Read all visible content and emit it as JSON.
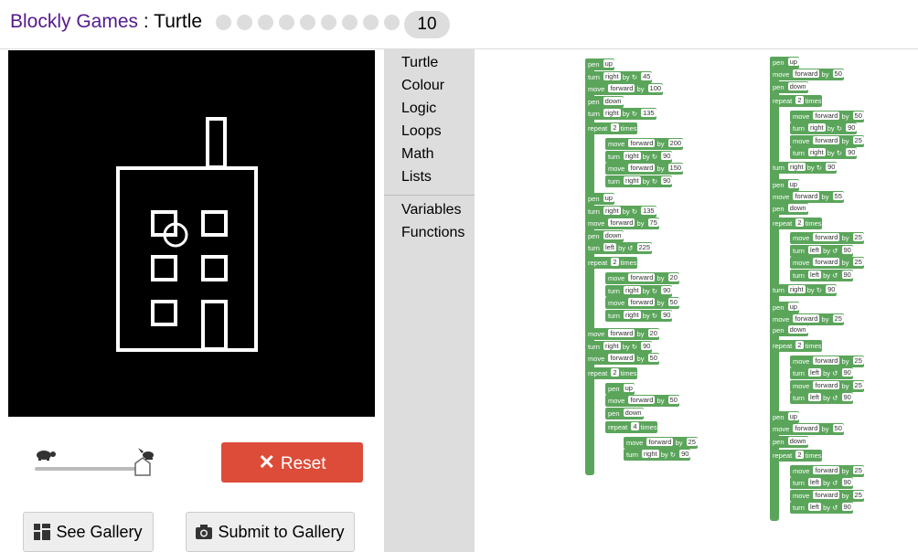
{
  "header": {
    "app_name": "Blockly Games",
    "separator": " : ",
    "game_name": "Turtle",
    "current_level": "10",
    "level_count": 9
  },
  "controls": {
    "reset_label": "Reset",
    "see_gallery_label": "See Gallery",
    "submit_gallery_label": "Submit to Gallery",
    "speed": 0.95
  },
  "toolbox": {
    "categories": [
      "Turtle",
      "Colour",
      "Logic",
      "Loops",
      "Math",
      "Lists",
      "Variables",
      "Functions"
    ]
  },
  "workspace": {
    "col1": [
      "pen up",
      "turn right by ↻ 45",
      "move forward by 100",
      "pen down",
      "turn right by ↻ 135",
      "repeat 2 times",
      "move forward by 200",
      "turn right by ↻ 90",
      "move forward by 150",
      "turn right by ↻ 90",
      "pen up",
      "turn right by ↻ 135",
      "move forward by 75",
      "pen down",
      "turn left by ↺ 225",
      "repeat 2 times",
      "move forward by 20",
      "turn right by ↻ 90",
      "move forward by 50",
      "turn right by ↻ 90",
      "move forward by 20",
      "turn right by ↻ 90",
      "move forward by 50",
      "repeat 2 times",
      "pen up",
      "move forward by 50",
      "pen down",
      "repeat 4 times",
      "move forward by 25",
      "turn right by ↻ 90"
    ],
    "col2": [
      "pen up",
      "move forward by 50",
      "pen down",
      "repeat 2 times",
      "move forward by 50",
      "turn right by ↻ 90",
      "move forward by 25",
      "turn right by ↻ 90",
      "turn right by ↻ 90",
      "pen up",
      "move forward by 55",
      "pen down",
      "repeat 2 times",
      "move forward by 25",
      "turn left by ↺ 90",
      "move forward by 25",
      "turn left by ↺ 90",
      "turn right by ↻ 90",
      "pen up",
      "move forward by 25",
      "pen down",
      "repeat 2 times",
      "move forward by 25",
      "turn left by ↺ 90",
      "move forward by 25",
      "turn left by ↺ 90",
      "pen up",
      "move forward by 50",
      "pen down",
      "repeat 2 times",
      "move forward by 25",
      "turn left by ↺ 90",
      "move forward by 25",
      "turn left by ↺ 90"
    ]
  }
}
